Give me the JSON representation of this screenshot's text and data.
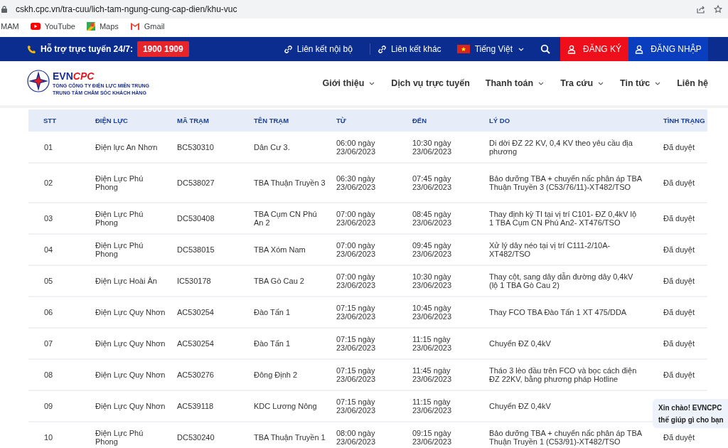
{
  "browser": {
    "url": "cskh.cpc.vn/tra-cuu/lich-tam-ngung-cung-cap-dien/khu-vuc",
    "bookmarks": [
      {
        "kind": "plain",
        "label": "MAM"
      },
      {
        "kind": "youtube",
        "label": "YouTube"
      },
      {
        "kind": "maps",
        "label": "Maps"
      },
      {
        "kind": "gmail",
        "label": "Gmail"
      }
    ]
  },
  "top_bar": {
    "hotline_label": "Hỗ trợ trực tuyến 24/7:",
    "hotline_number": "1900 1909",
    "links": [
      {
        "kind": "link",
        "label": "Liên kết nội bộ"
      },
      {
        "kind": "link",
        "label": "Liên kết khác"
      },
      {
        "kind": "language",
        "label": "Tiếng Việt"
      }
    ],
    "register": "ĐĂNG KÝ",
    "login": "ĐĂNG NHẬP"
  },
  "header": {
    "logo": {
      "brand_a": "EVN",
      "brand_b": "CPC",
      "line_1": "TỔNG CÔNG TY ĐIỆN LỰC MIỀN TRUNG",
      "line_2": "TRUNG TÂM CHĂM SÓC KHÁCH HÀNG"
    },
    "nav": [
      {
        "label": "Giới thiệu",
        "has_menu": true
      },
      {
        "label": "Dịch vụ trực tuyến",
        "has_menu": false
      },
      {
        "label": "Thanh toán",
        "has_menu": true
      },
      {
        "label": "Tra cứu",
        "has_menu": true
      },
      {
        "label": "Tin tức",
        "has_menu": true
      },
      {
        "label": "Liên hệ",
        "has_menu": false
      }
    ]
  },
  "table": {
    "columns": [
      "STT",
      "ĐIỆN LỰC",
      "MÃ TRẠM",
      "TÊN TRẠM",
      "TỪ",
      "ĐẾN",
      "LÝ DO",
      "TÌNH TRẠNG"
    ],
    "rows": [
      [
        "01",
        "Điện lực An Nhơn",
        "BC530310",
        "Dân Cư 3.",
        "06:00 ngày 23/06/2023",
        "10:30 ngày 23/06/2023",
        "Di dời ĐZ 22 KV, 0,4 KV theo yêu cầu địa phương",
        "Đã duyệt"
      ],
      [
        "02",
        "Điện Lực Phú Phong",
        "DC538027",
        "TBA Thuận Truyền 3",
        "06:30 ngày 23/06/2023",
        "07:45 ngày 23/06/2023",
        "Bảo dưỡng TBA + chuyển nấc phân áp TBA Thuận Truyền 3 (C53/76/11)-XT482/TSO",
        "Đã duyệt"
      ],
      [
        "03",
        "Điện Lực Phú Phong",
        "DC530408",
        "TBA Cụm CN Phú An 2",
        "07:00 ngày 23/06/2023",
        "08:45 ngày 23/06/2023",
        "Thay định kỳ TI tại vị trí C101- ĐZ 0,4kV lộ 1 TBA Cụm CN Phú An2- XT476/TSO",
        "Đã duyệt"
      ],
      [
        "04",
        "Điện Lực Phú Phong",
        "DC538015",
        "TBA Xóm Nam",
        "07:00 ngày 23/06/2023",
        "09:45 ngày 23/06/2023",
        "Xử lý dây néo tại vị trí C111-2/10A-XT482/TSO",
        "Đã duyệt"
      ],
      [
        "05",
        "Điện Lực Hoài Ân",
        "IC530178",
        "TBA Gò Cau 2",
        "07:00 ngày 23/06/2023",
        "10:30 ngày 23/06/2023",
        "Thay cột, sang dây dẫn đường dây 0,4kV (lộ 1 TBA Gò Cau 2)",
        "Đã duyệt"
      ],
      [
        "06",
        "Điện Lực Quy Nhơn",
        "AC530254",
        "Đào Tấn 1",
        "07:15 ngày 23/06/2023",
        "10:45 ngày 23/06/2023",
        "Thay FCO TBA Đào Tấn 1 XT 475/DDA",
        "Đã duyệt"
      ],
      [
        "07",
        "Điện Lực Quy Nhơn",
        "AC530254",
        "Đào Tấn 1",
        "07:15 ngày 23/06/2023",
        "11:15 ngày 23/06/2023",
        "Chuyển ĐZ 0,4kV",
        "Đã duyệt"
      ],
      [
        "08",
        "Điện Lực Quy Nhơn",
        "AC530276",
        "Đông Định 2",
        "07:15 ngày 23/06/2023",
        "11:45 ngày 23/06/2023",
        "Tháo 3 lèo đầu trên FCO và bọc cách điện ĐZ 22KV, bằng phương pháp Hotline",
        "Đã duyệt"
      ],
      [
        "09",
        "Điện Lực Quy Nhơn",
        "AC539118",
        "KDC Lương Nông",
        "07:15 ngày 23/06/2023",
        "11:15 ngày 23/06/2023",
        "Chuyển ĐZ 0,4kV"
      ],
      [
        "10",
        "Điện Lực Phú Phong",
        "DC530240",
        "TBA Thuận Truyền 1",
        "08:00 ngày 23/06/2023",
        "09:15 ngày 23/06/2023",
        "Bảo dưỡng TBA + chuyển nấc phân áp TBA Thuận Truyền 1 (C53/91)-XT482/TSO",
        "Đã duyệt"
      ]
    ]
  },
  "chat_bubble": {
    "line_1": "Xin chào! EVNCPC",
    "line_2": "thế giúp gì cho bạn"
  }
}
